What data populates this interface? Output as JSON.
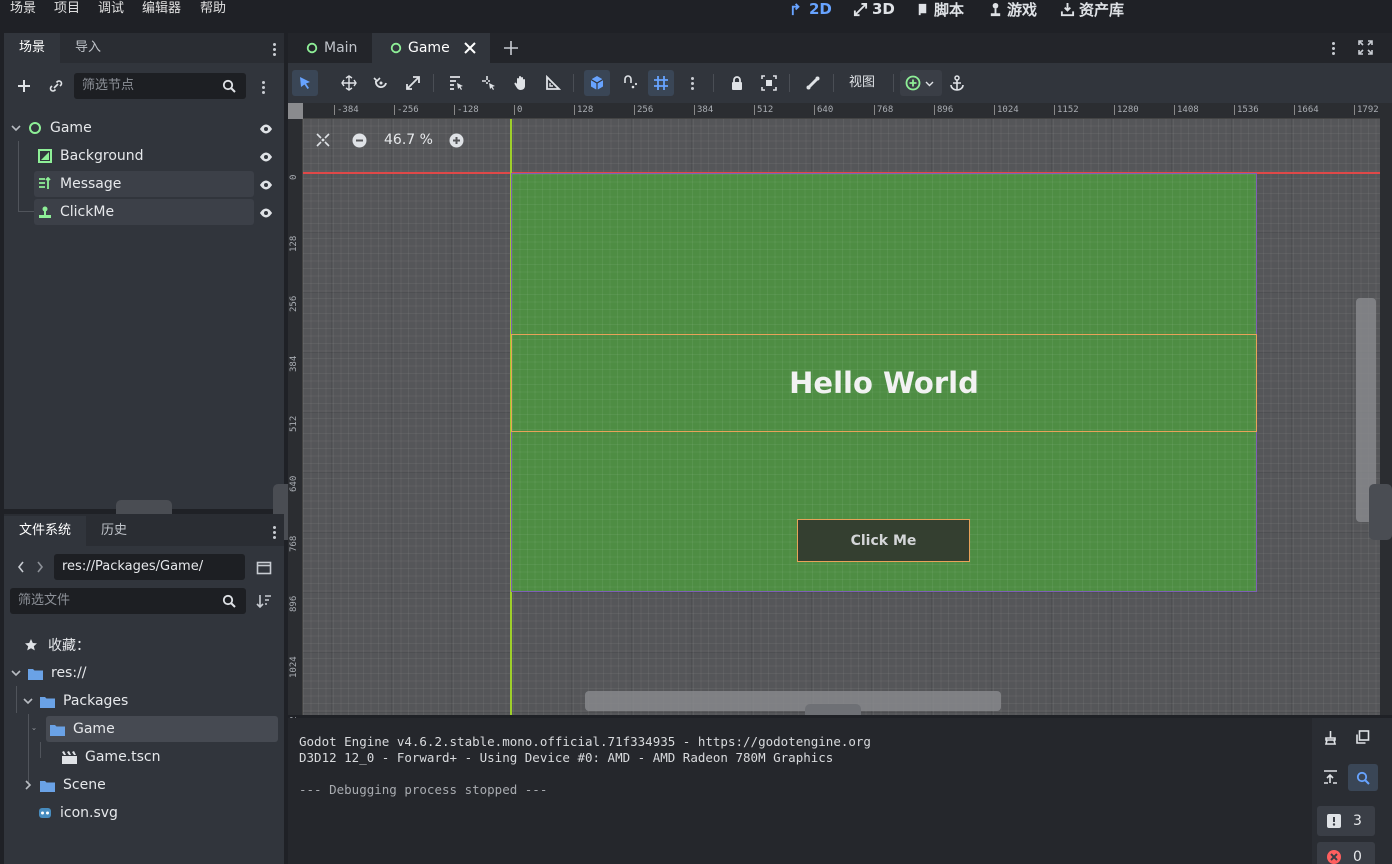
{
  "menu": [
    "场景",
    "项目",
    "调试",
    "编辑器",
    "帮助"
  ],
  "modes": [
    {
      "label": "2D",
      "icon": "2d-icon",
      "active": true
    },
    {
      "label": "3D",
      "icon": "3d-icon",
      "active": false
    },
    {
      "label": "脚本",
      "icon": "script-icon",
      "active": false
    },
    {
      "label": "游戏",
      "icon": "game-icon",
      "active": false
    },
    {
      "label": "资产库",
      "icon": "asset-lib-icon",
      "active": false
    }
  ],
  "scene_dock": {
    "tabs": [
      "场景",
      "导入"
    ],
    "filter_placeholder": "筛选节点",
    "nodes": [
      {
        "name": "Game",
        "icon": "node-circle-icon",
        "color": "#8eef97"
      },
      {
        "name": "Background",
        "icon": "colorrect-icon",
        "color": "#8eef97"
      },
      {
        "name": "Message",
        "icon": "label-icon",
        "color": "#8eef97"
      },
      {
        "name": "ClickMe",
        "icon": "button-icon",
        "color": "#8eef97"
      }
    ]
  },
  "file_dock": {
    "tabs": [
      "文件系统",
      "历史"
    ],
    "path": "res://Packages/Game/",
    "filter_placeholder": "筛选文件",
    "favorites_label": "收藏：",
    "tree": [
      {
        "name": "res://",
        "type": "folder"
      },
      {
        "name": "Packages",
        "type": "folder"
      },
      {
        "name": "Game",
        "type": "folder"
      },
      {
        "name": "Game.tscn",
        "type": "scene"
      },
      {
        "name": "Scene",
        "type": "folder"
      },
      {
        "name": "icon.svg",
        "type": "image"
      }
    ]
  },
  "editor_tabs": [
    {
      "label": "Main",
      "active": false
    },
    {
      "label": "Game",
      "active": true
    }
  ],
  "toolbar": {
    "view_label": "视图"
  },
  "viewport": {
    "zoom": "46.7 %",
    "ruler_top": [
      "-384",
      "-256",
      "-128",
      "0",
      "128",
      "256",
      "384",
      "512",
      "640",
      "768",
      "896",
      "1024",
      "1152",
      "1280",
      "1408",
      "1536",
      "1664",
      "1792"
    ],
    "ruler_left": [
      "0",
      "128",
      "256",
      "384",
      "512",
      "640",
      "768",
      "896",
      "1024",
      "1152"
    ],
    "message_text": "Hello World",
    "button_text": "Click Me",
    "background_color": "#4e8f43"
  },
  "output": {
    "lines": [
      "Godot Engine v4.6.2.stable.mono.official.71f334935 - https://godotengine.org",
      "D3D12 12_0 - Forward+ - Using Device #0: AMD - AMD Radeon 780M Graphics",
      "",
      "--- Debugging process stopped ---"
    ],
    "warning_count": "3",
    "error_count": "0"
  }
}
